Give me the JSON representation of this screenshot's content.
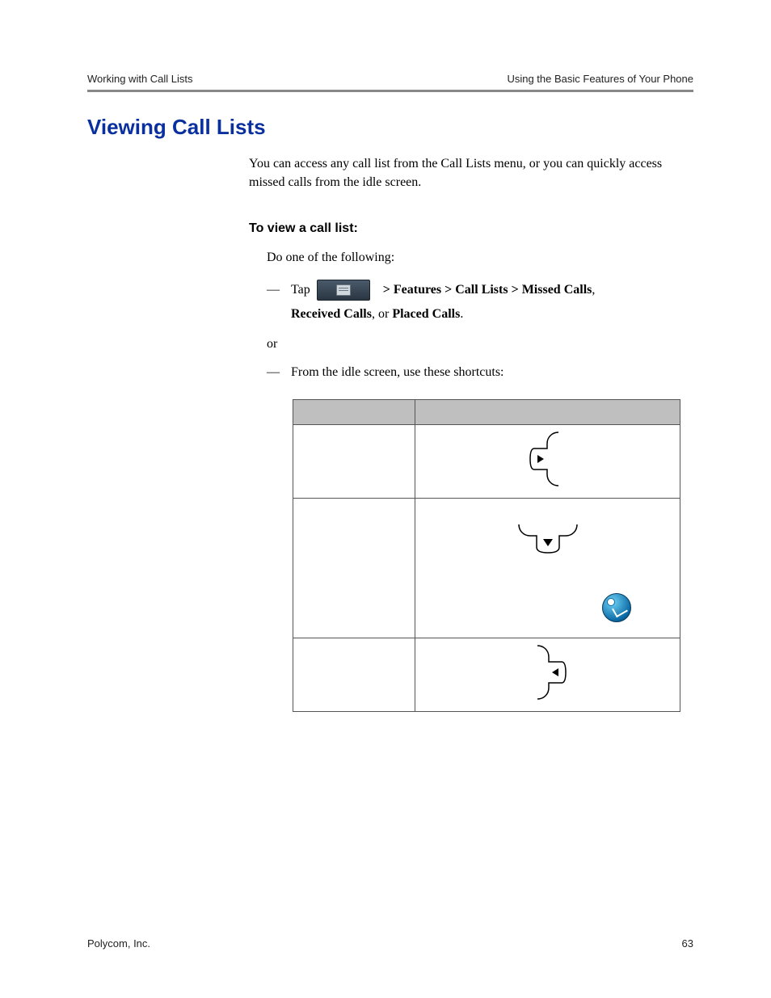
{
  "header": {
    "left": "Working with Call Lists",
    "right": "Using the Basic Features of Your Phone"
  },
  "section_title": "Viewing Call Lists",
  "intro": "You can access any call list from the Call Lists menu, or you can quickly access missed calls from the idle screen.",
  "subhead": "To view a call list:",
  "lead_in": "Do one of the following:",
  "tap_prefix": "Tap ",
  "tap_path_1": "> Features > Call Lists > Missed Calls",
  "tap_path_sep": ", ",
  "tap_path_2": "Received Calls",
  "tap_path_mid": ", or ",
  "tap_path_3": "Placed Calls",
  "tap_path_end": ".",
  "or": "or",
  "shortcut_line": "From the idle screen, use these shortcuts:",
  "footer": {
    "left": "Polycom, Inc.",
    "right": "63"
  }
}
